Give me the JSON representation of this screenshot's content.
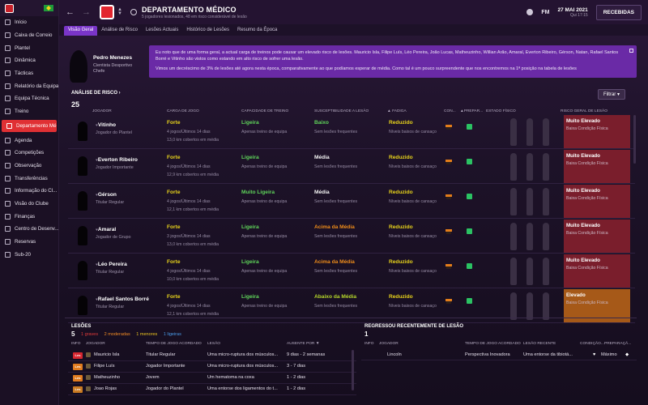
{
  "sidebar": {
    "items": [
      {
        "label": "Início",
        "icon": "home-icon"
      },
      {
        "label": "Caixa de Correio",
        "icon": "mail-icon"
      },
      {
        "label": "Plantel",
        "icon": "squad-icon"
      },
      {
        "label": "Dinâmica",
        "icon": "dynamics-icon"
      },
      {
        "label": "Tácticas",
        "icon": "tactics-icon"
      },
      {
        "label": "Relatório da Equipa",
        "icon": "report-icon"
      },
      {
        "label": "Equipa Técnica",
        "icon": "staff-icon"
      },
      {
        "label": "Treino",
        "icon": "training-icon"
      },
      {
        "label": "Departamento Mé...",
        "icon": "medical-icon",
        "active": true
      },
      {
        "label": "Agenda",
        "icon": "calendar-icon"
      },
      {
        "label": "Competições",
        "icon": "trophy-icon"
      },
      {
        "label": "Observação",
        "icon": "scouting-icon"
      },
      {
        "label": "Transferências",
        "icon": "transfer-icon"
      },
      {
        "label": "Informação do Cl...",
        "icon": "info-icon"
      },
      {
        "label": "Visão do Clube",
        "icon": "vision-icon"
      },
      {
        "label": "Finanças",
        "icon": "finance-icon"
      },
      {
        "label": "Centro de Desenv...",
        "icon": "development-icon"
      },
      {
        "label": "Reservas",
        "icon": "reserves-icon"
      },
      {
        "label": "Sub-20",
        "icon": "u20-icon"
      }
    ]
  },
  "header": {
    "title": "DEPARTAMENTO MÉDICO",
    "subtitle": "5 jogadores lesionados, 48 em risco considerável de lesão",
    "brand": "FM",
    "date": "27 MAI 2021",
    "time": "Qui 17:15",
    "button": "RECEBIDAS"
  },
  "tabs": [
    "Visão Geral",
    "Análise de Risco",
    "Lesões Actuais",
    "Histórico de Lesões",
    "Resumo da Época"
  ],
  "profile": {
    "name": "Pedro Menezes",
    "role": "Cientista Desportivo",
    "role2": "Chefe"
  },
  "message": {
    "p1": "Eu noto que de uma forma geral, a actual carga de treinos pode causar um elevado risco de lesões. Mauricio Isla, Filipe Luís, Léo Pereira, João Lucas, Matheuzinho, Willian Arão, Amaral, Everton Ribeiro, Gérson, Natan, Rafael Santos Borré e Vitinho são vistos como estando em alto risco de sofrer uma lesão.",
    "p2": "Vimos um decréscimo de 3% de lesões até agora nesta época, comparativamente ao que podíamos esperar de média. Como tal é um pouco surpreendente que nos encontremos na 1ª posição na tabela de lesões"
  },
  "risk": {
    "title": "ANÁLISE DE RISCO",
    "count": "25",
    "filter": "Filtrar",
    "headers": {
      "player": "JOGADOR",
      "load": "CARGA DE JOGO",
      "training": "CAPACIDADE DE TREINO",
      "susceptibility": "SUSCEPTIBILIDADE A LESÃO",
      "fatigue": "FADIGA",
      "condition": "CON...",
      "prep": "PREPAR...",
      "physical": "ESTADO FÍSICO",
      "overall": "RISCO GERAL DE LESÃO"
    },
    "rows": [
      {
        "name": "Vitinho",
        "role": "Jogador do Plantel",
        "load": "Forte",
        "load_s1": "4 jogos/Últimos 14 dias",
        "load_s2": "13,0 km cobertos em média",
        "training": "Ligeira",
        "training_s": "Apenas treino de equipa",
        "susc": "Baixo",
        "susc_class": "green",
        "susc_s": "Sem lesões frequentes",
        "fatigue": "Reduzido",
        "fatigue_s": "Níveis baixos de cansaço",
        "risk": "Muito Elevado",
        "risk_s": "Baixa Condição Física",
        "risk_class": "rc-red"
      },
      {
        "name": "Everton Ribeiro",
        "role": "Jogador Importante",
        "load": "Forte",
        "load_s1": "4 jogos/Últimos 14 dias",
        "load_s2": "12,9 km cobertos em média",
        "training": "Ligeira",
        "training_s": "Apenas treino de equipa",
        "susc": "Média",
        "susc_class": "white",
        "susc_s": "Sem lesões frequentes",
        "fatigue": "Reduzido",
        "fatigue_s": "Níveis baixos de cansaço",
        "risk": "Muito Elevado",
        "risk_s": "Baixa Condição Física",
        "risk_class": "rc-red"
      },
      {
        "name": "Gérson",
        "role": "Titular Regular",
        "load": "Forte",
        "load_s1": "4 jogos/Últimos 14 dias",
        "load_s2": "12,1 km cobertos em média",
        "training": "Muito Ligeira",
        "training_s": "Apenas treino de equipa",
        "susc": "Média",
        "susc_class": "white",
        "susc_s": "Sem lesões frequentes",
        "fatigue": "Reduzido",
        "fatigue_s": "Níveis baixos de cansaço",
        "risk": "Muito Elevado",
        "risk_s": "Baixa Condição Física",
        "risk_class": "rc-red"
      },
      {
        "name": "Amaral",
        "role": "Jogador de Grupo",
        "load": "Forte",
        "load_s1": "3 jogos/Últimos 14 dias",
        "load_s2": "13,0 km cobertos em média",
        "training": "Ligeira",
        "training_s": "Apenas treino de equipa",
        "susc": "Acima da Média",
        "susc_class": "orange",
        "susc_s": "Sem lesões frequentes",
        "fatigue": "Reduzido",
        "fatigue_s": "Níveis baixos de cansaço",
        "risk": "Muito Elevado",
        "risk_s": "Baixa Condição Física",
        "risk_class": "rc-red"
      },
      {
        "name": "Léo Pereira",
        "role": "Titular Regular",
        "load": "Forte",
        "load_s1": "4 jogos/Últimos 14 dias",
        "load_s2": "10,0 km cobertos em média",
        "training": "Ligeira",
        "training_s": "Apenas treino de equipa",
        "susc": "Acima da Média",
        "susc_class": "orange",
        "susc_s": "Sem lesões frequentes",
        "fatigue": "Reduzido",
        "fatigue_s": "Níveis baixos de cansaço",
        "risk": "Muito Elevado",
        "risk_s": "Baixa Condição Física",
        "risk_class": "rc-red"
      },
      {
        "name": "Rafael Santos Borré",
        "role": "Titular Regular",
        "load": "Forte",
        "load_s1": "4 jogos/Últimos 14 dias",
        "load_s2": "12,1 km cobertos em média",
        "training": "Ligeira",
        "training_s": "Apenas treino de equipa",
        "susc": "Abaixo da Média",
        "susc_class": "lime",
        "susc_s": "Sem lesões frequentes",
        "fatigue": "Reduzido",
        "fatigue_s": "Níveis baixos de cansaço",
        "risk": "Elevado",
        "risk_s": "Baixa Condição Física",
        "risk_class": "rc-orange"
      }
    ]
  },
  "injuries": {
    "title": "LESÕES",
    "count": "5",
    "legend": {
      "serious": "1 graves",
      "moderate": "2 moderadas",
      "minor": "1 menores",
      "light": "1 ligeiras"
    },
    "colors": {
      "serious": "#e23b3b",
      "moderate": "#f08a24",
      "minor": "#e8c020",
      "light": "#4a9ae8"
    },
    "headers": {
      "info": "INFO",
      "player": "JOGADOR",
      "time": "TEMPO DE JOGO ACORDADO",
      "injury": "LESÃO",
      "out": "AUSENTE POR"
    },
    "rows": [
      {
        "tag": "Les",
        "tag_color": "#d6262f",
        "player": "Mauricio Isla",
        "time": "Titular Regular",
        "injury": "Uma micro-ruptura dos músculos...",
        "out": "9 dias - 2 semanas"
      },
      {
        "tag": "Les",
        "tag_color": "#e07b1e",
        "player": "Filipe Luís",
        "time": "Jogador Importante",
        "injury": "Uma micro-ruptura dos músculos...",
        "out": "3 - 7 dias"
      },
      {
        "tag": "Les",
        "tag_color": "#e07b1e",
        "player": "Matheuzinho",
        "time": "Jovem",
        "injury": "Um hematoma na coxa",
        "out": "1 - 2 dias"
      },
      {
        "tag": "Les",
        "tag_color": "#c97a22",
        "player": "Joao Rojas",
        "time": "Jogador do Plantel",
        "injury": "Uma entorse dos ligamentos do t...",
        "out": "1 - 2 dias"
      }
    ]
  },
  "returns": {
    "title": "REGRESSOU RECENTEMENTE DE LESÃO",
    "count": "1",
    "headers": {
      "info": "INFO",
      "player": "JOGADOR",
      "time": "TEMPO DE JOGO ACORDADO",
      "injury": "LESÃO RECENTE",
      "condition": "CONDIÇÃO...",
      "prep": "PREPARAÇÃ..."
    },
    "rows": [
      {
        "player": "Lincoln",
        "time": "Perspectiva Inovadora",
        "injury": "Uma entorse da tibiotá...",
        "prep": "Máximo"
      }
    ]
  }
}
